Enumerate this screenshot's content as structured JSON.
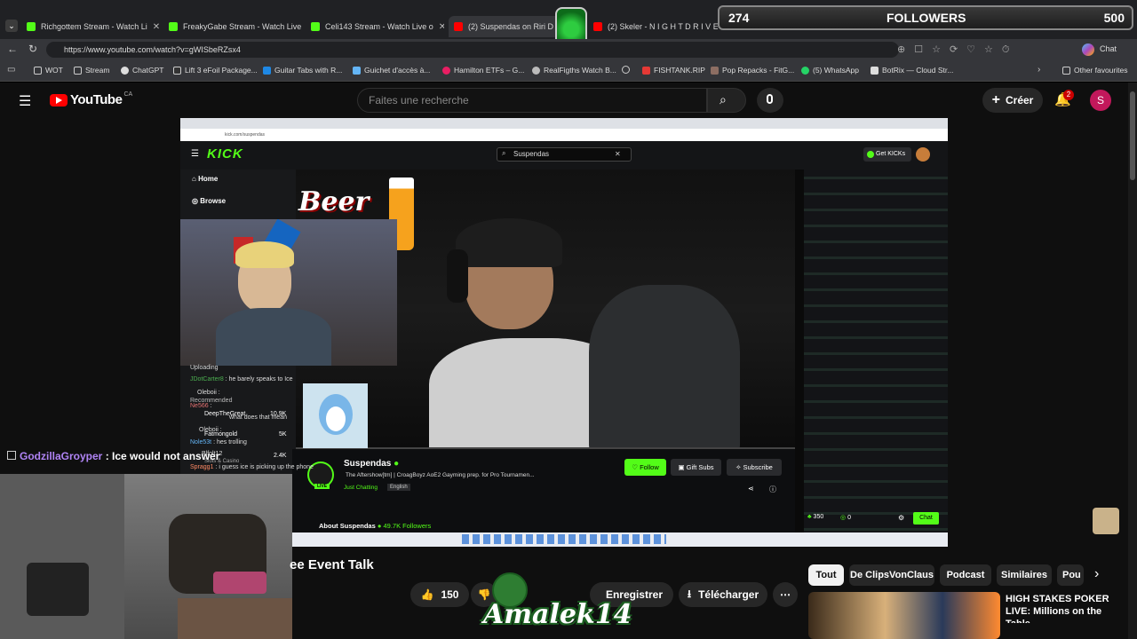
{
  "browser": {
    "tabs": [
      {
        "label": "Richgottem Stream - Watch Li",
        "color": "#53fc18"
      },
      {
        "label": "FreakyGabe Stream - Watch Live o",
        "color": "#53fc18"
      },
      {
        "label": "Celi143 Stream - Watch Live o",
        "color": "#53fc18"
      },
      {
        "label": "(2) Suspendas on Riri D",
        "color": "#ff0000"
      },
      {
        "label": "(2) Skeler - N I G H T D R I V E",
        "color": "#ff0000"
      }
    ],
    "url": "https://www.youtube.com/watch?v=gWISbeRZsx4",
    "bookmarks": [
      "WOT",
      "Stream",
      "ChatGPT",
      "Lift 3 eFoil Package...",
      "Guitar Tabs with R...",
      "Guichet d'accès à...",
      "Hamilton ETFs – G...",
      "RealFigths Watch B...",
      "FISHTANK.RIP",
      "Pop Repacks - FitG...",
      "(5) WhatsApp",
      "BotRix — Cloud Str..."
    ],
    "other_favourites": "Other favourites",
    "chat_label": "Chat"
  },
  "followers_overlay": {
    "current": "274",
    "label": "FOLLOWERS",
    "goal": "500"
  },
  "youtube": {
    "logo": "YouTube",
    "region": "CA",
    "search_placeholder": "Faites une recherche",
    "create_label": "Créer",
    "notif_count": "2",
    "avatar_letter": "S",
    "video_title": "ee Event Talk",
    "likes": "150",
    "save_label": "Enregistrer",
    "download_label": "Télécharger",
    "chips": [
      "Tout",
      "De ClipsVonClaus",
      "Podcast",
      "Similaires",
      "Pou"
    ],
    "suggested_title": "HIGH STAKES POKER LIVE: Millions on the Table",
    "overlay_logo": "Amalek14"
  },
  "kick": {
    "logo": "KICK",
    "search_value": "Suspendas",
    "get_kicks": "Get KICKs",
    "nav": [
      "Home",
      "Browse"
    ],
    "recommended": "Recommended",
    "streamer": "Suspendas",
    "stream_title": "The Aftershow[tm] | CroagBoyz AoE2 Gayming prep. for Pro Tournamen...",
    "category": "Just Chatting",
    "language": "English",
    "follow": "Follow",
    "gift_subs": "Gift Subs",
    "subscribe": "Subscribe",
    "about": "About Suspendas",
    "followers": "49.7K Followers",
    "viewers": "350",
    "points": "0",
    "chat_btn": "Chat",
    "live_badge": "LIVE",
    "beer_text": "Beer",
    "sidebar_items": [
      {
        "name": "DeepTheGreat",
        "count": "10.9K"
      },
      {
        "name": "Fatmongold",
        "count": "5K"
      },
      {
        "name": "Slots & Casino",
        "count": "2.4K"
      }
    ]
  },
  "chat_overlay": [
    {
      "user": "Uploading",
      "msg": ""
    },
    {
      "user": "JDotCarter8",
      "msg": "he barely speaks to Ice"
    },
    {
      "user": "Oleboii",
      "msg": ""
    },
    {
      "user": "Ne566",
      "msg": ""
    },
    {
      "user": "Sacho",
      "msg": "what does that mean"
    },
    {
      "user": "Oleboii",
      "msg": ""
    },
    {
      "user": "Nole53t",
      "msg": "hes trolling"
    },
    {
      "user": "Blfolt12",
      "msg": ""
    },
    {
      "user": "Spragg1",
      "msg": "i guess ice is picking up the phone"
    }
  ],
  "godzilla_chat": {
    "user": "GodzillaGroyper",
    "msg": "Ice would not answer"
  }
}
